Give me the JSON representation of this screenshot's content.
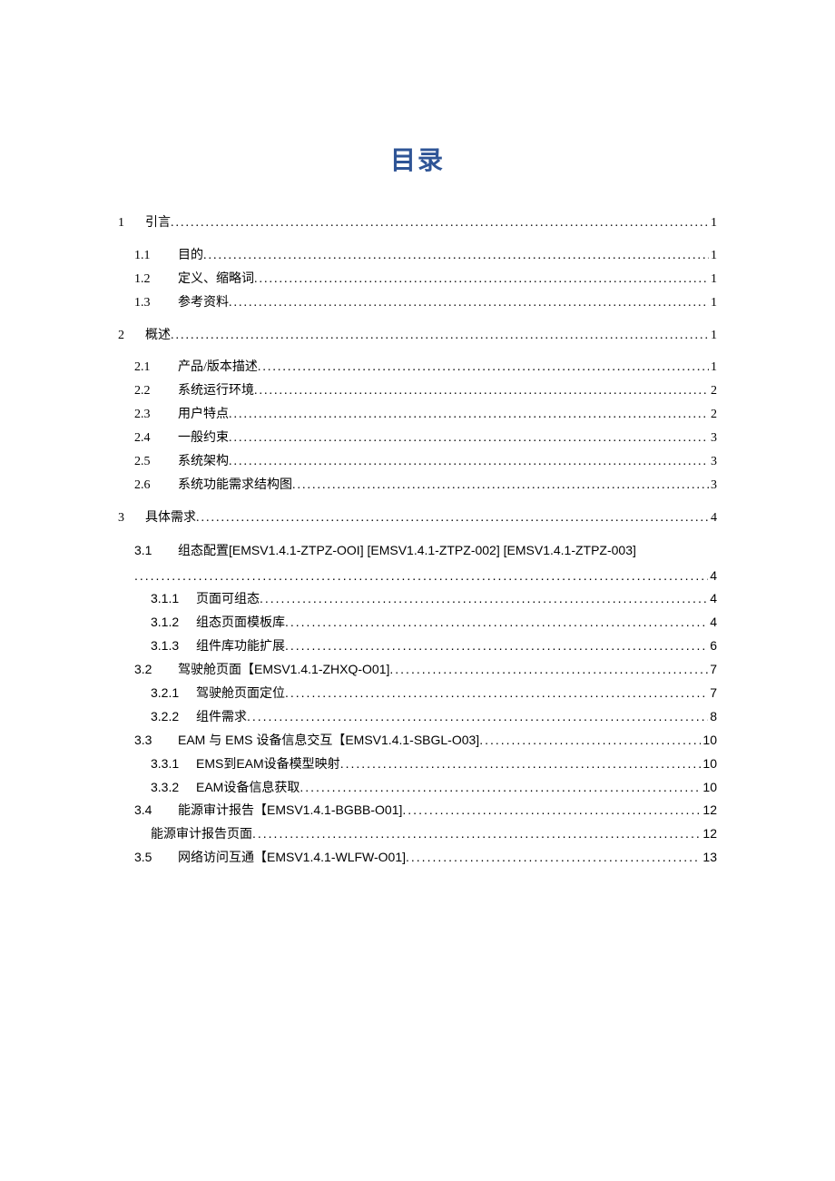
{
  "title": "目录",
  "toc": [
    {
      "indent": 0,
      "num": "1",
      "numClass": "num-w1",
      "label": "引言",
      "page": "1",
      "gap": false
    },
    {
      "indent": 1,
      "num": "1.1",
      "numClass": "num-w2",
      "label": "目的",
      "page": "1",
      "gap": true
    },
    {
      "indent": 1,
      "num": "1.2",
      "numClass": "num-w2",
      "label": "定义、缩略词",
      "page": "1"
    },
    {
      "indent": 1,
      "num": "1.3",
      "numClass": "num-w2",
      "label": "参考资料",
      "page": "1"
    },
    {
      "indent": 0,
      "num": "2",
      "numClass": "num-w1",
      "label": "概述",
      "page": "1",
      "gap": true
    },
    {
      "indent": 1,
      "num": "2.1",
      "numClass": "num-w2",
      "label": "产品/版本描述",
      "page": "1",
      "gap": true
    },
    {
      "indent": 1,
      "num": "2.2",
      "numClass": "num-w2",
      "label": "系统运行环境",
      "page": "2"
    },
    {
      "indent": 1,
      "num": "2.3",
      "numClass": "num-w2",
      "label": "用户特点",
      "page": "2"
    },
    {
      "indent": 1,
      "num": "2.4",
      "numClass": "num-w2",
      "label": "一般约束",
      "page": "3"
    },
    {
      "indent": 1,
      "num": "2.5",
      "numClass": "num-w2",
      "label": "系统架构",
      "page": "3"
    },
    {
      "indent": 1,
      "num": "2.6",
      "numClass": "num-w2",
      "label": "系统功能需求结构图",
      "page": "3"
    },
    {
      "indent": 0,
      "num": "3",
      "numClass": "num-w1",
      "label": "具体需求",
      "page": "4",
      "gap": true
    },
    {
      "indent": 2,
      "num": "3.1",
      "numClass": "num-w2",
      "label": "组态配置[EMSV1.4.1-ZTPZ-OOI] [EMSV1.4.1-ZTPZ-002] [EMSV1.4.1-ZTPZ-003]",
      "page": "4",
      "gap": true,
      "wrap": true,
      "sans": true
    },
    {
      "indent": 3,
      "num": "3.1.1",
      "numClass": "num-w3",
      "label": "页面可组态 ",
      "page": "4",
      "sans": true
    },
    {
      "indent": 3,
      "num": "3.1.2",
      "numClass": "num-w3",
      "label": "组态页面模板库 ",
      "page": "4",
      "sans": true
    },
    {
      "indent": 3,
      "num": "3.1.3",
      "numClass": "num-w3",
      "label": "组件库功能扩展 ",
      "page": "6",
      "sans": true
    },
    {
      "indent": 2,
      "num": "3.2",
      "numClass": "num-w2",
      "label": "驾驶舱页面【EMSV1.4.1-ZHXQ-O01] ",
      "page": "7",
      "sans": true
    },
    {
      "indent": 3,
      "num": "3.2.1",
      "numClass": "num-w3",
      "label": "驾驶舱页面定位 ",
      "page": "7",
      "sans": true
    },
    {
      "indent": 3,
      "num": "3.2.2",
      "numClass": "num-w3",
      "label": "组件需求 ",
      "page": "8",
      "sans": true
    },
    {
      "indent": 2,
      "num": "3.3",
      "numClass": "num-w2",
      "label": "EAM 与 EMS 设备信息交互【EMSV1.4.1-SBGL-O03]",
      "page": "10",
      "sans": true
    },
    {
      "indent": 3,
      "num": "3.3.1",
      "numClass": "num-w3",
      "label": "EMS到EAM设备模型映射",
      "page": " 10",
      "sans": true
    },
    {
      "indent": 3,
      "num": "3.3.2",
      "numClass": "num-w3",
      "label": "EAM设备信息获取 ",
      "page": " 10",
      "sans": true
    },
    {
      "indent": 2,
      "num": "3.4",
      "numClass": "num-w2",
      "label": "能源审计报告【EMSV1.4.1-BGBB-O01] ",
      "page": "12",
      "sans": true
    },
    {
      "indent": 3,
      "num": "",
      "numClass": "",
      "label": "能源审计报告页面 ",
      "page": " 12",
      "sans": true
    },
    {
      "indent": 2,
      "num": "3.5",
      "numClass": "num-w2",
      "label": "网络访问互通【EMSV1.4.1-WLFW-O01] ",
      "page": "13",
      "sans": true
    }
  ]
}
